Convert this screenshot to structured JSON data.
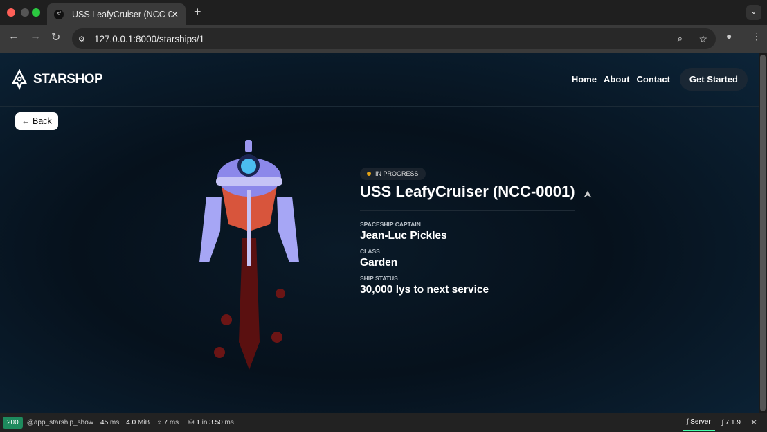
{
  "browser": {
    "tab_title": "USS LeafyCruiser (NCC-0001)",
    "tab_favicon": "sf",
    "url": "127.0.0.1:8000/starships/1"
  },
  "site": {
    "logo": "STARSHOP",
    "nav": [
      "Home",
      "About",
      "Contact"
    ],
    "cta": "Get Started",
    "back": "Back"
  },
  "ship": {
    "status": "IN PROGRESS",
    "status_color": "#e4a316",
    "name": "USS LeafyCruiser (NCC-0001)",
    "fields": [
      {
        "label": "SPACESHIP CAPTAIN",
        "value": "Jean-Luc Pickles"
      },
      {
        "label": "CLASS",
        "value": "Garden"
      },
      {
        "label": "SHIP STATUS",
        "value": "30,000 lys to next service"
      }
    ]
  },
  "toolbar": {
    "code": "200",
    "route": "@app_starship_show",
    "time": "45",
    "time_unit": "ms",
    "memory": "4.0",
    "memory_unit": "MiB",
    "twig": "7",
    "twig_unit": "ms",
    "db_count": "1",
    "db_in": "in",
    "db_time": "3.50",
    "db_unit": "ms",
    "server": "Server",
    "version": "7.1.9"
  }
}
